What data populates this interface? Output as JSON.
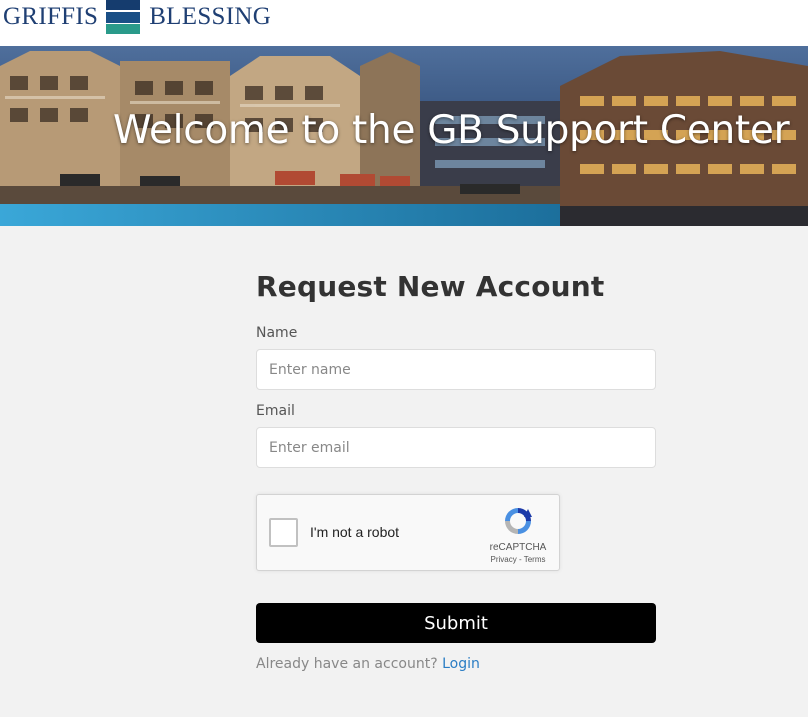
{
  "brand": {
    "left_word": "GRIFFIS",
    "right_word": "BLESSING"
  },
  "hero": {
    "title": "Welcome to the GB Support Center"
  },
  "form": {
    "title": "Request New Account",
    "name_label": "Name",
    "name_placeholder": "Enter name",
    "name_value": "",
    "email_label": "Email",
    "email_placeholder": "Enter email",
    "email_value": "",
    "captcha": {
      "label": "I'm not a robot",
      "brand": "reCAPTCHA",
      "privacy": "Privacy",
      "separator": " - ",
      "terms": "Terms",
      "checked": false
    },
    "submit_label": "Submit",
    "footer_prompt": "Already have an account?",
    "login_link": "Login"
  },
  "colors": {
    "logo_navy": "#1f3f73",
    "logo_teal": "#2a9a8a",
    "button_bg": "#000000",
    "link": "#2a7dc4",
    "page_bg": "#f2f2f2"
  },
  "icons": {
    "captcha_logo": "recaptcha-icon"
  }
}
